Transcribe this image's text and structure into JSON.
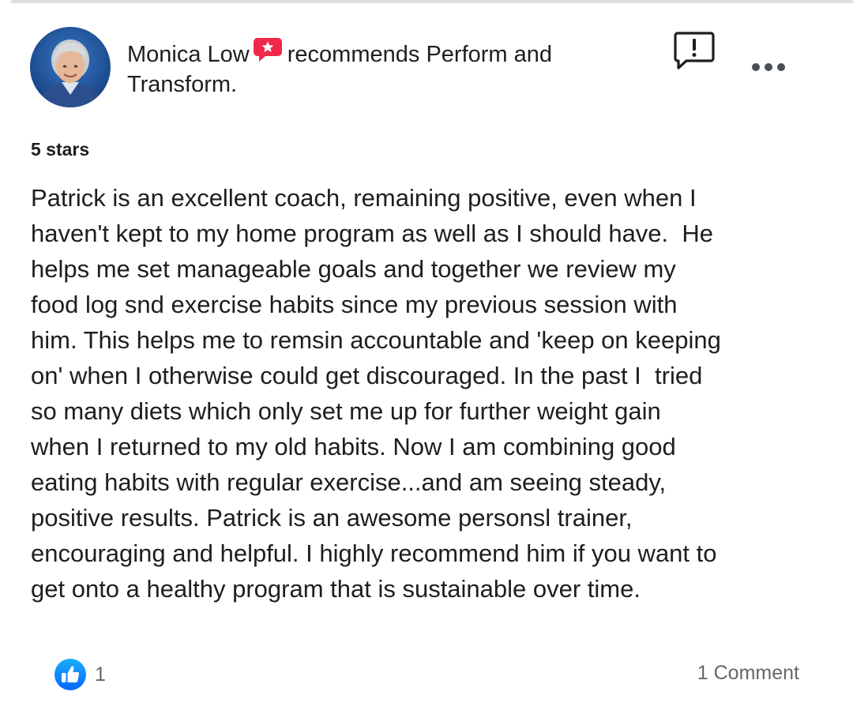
{
  "post": {
    "author": "Monica Low",
    "action_text": "recommends",
    "page_name": "Perform and Transform.",
    "rating": "5 stars",
    "review_lines": [
      "Patrick is an excellent coach, remaining positive, even when I",
      "haven't kept to my home program as well as I should have.  He",
      "helps me set manageable goals and together we review my",
      "food log snd exercise habits since my previous session with",
      "him. This helps me to remsin accountable and 'keep on keeping",
      "on' when I otherwise could get discouraged. In the past I  tried",
      "so many diets which only set me up for further weight gain",
      "when I returned to my old habits. Now I am combining good",
      "eating habits with regular exercise...and am seeing steady,",
      "positive results. Patrick is an awesome personsl trainer,",
      "encouraging and helpful. I highly recommend him if you want to",
      "get onto a healthy program that is sustainable over time."
    ],
    "reactions_count": "1",
    "comments_label": "1 Comment"
  },
  "icons": {
    "recommend_badge": "recommendation-star-badge-icon",
    "report": "report-exclamation-icon",
    "more": "more-options-icon",
    "like": "like-thumbs-up-icon"
  },
  "colors": {
    "recommend_badge": "#f02849",
    "like_blue": "#1877f2",
    "text_primary": "#1c1e21",
    "text_secondary": "#65676b"
  }
}
